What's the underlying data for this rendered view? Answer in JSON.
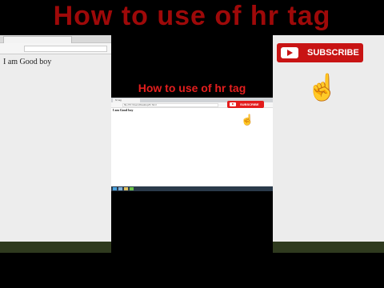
{
  "video": {
    "title": "How to use of hr tag",
    "background_title": "How to use of hr tag"
  },
  "browser": {
    "tab_title": "hr tag",
    "url": "file:///C:/Users/Desktop/hr.html",
    "page_text": "I am Good boy"
  },
  "overlay": {
    "subscribe_label": "SUBSCRIBE"
  },
  "colors": {
    "title_red": "#e41e1e",
    "subscribe_red": "#e31c1c",
    "background": "#000000"
  }
}
